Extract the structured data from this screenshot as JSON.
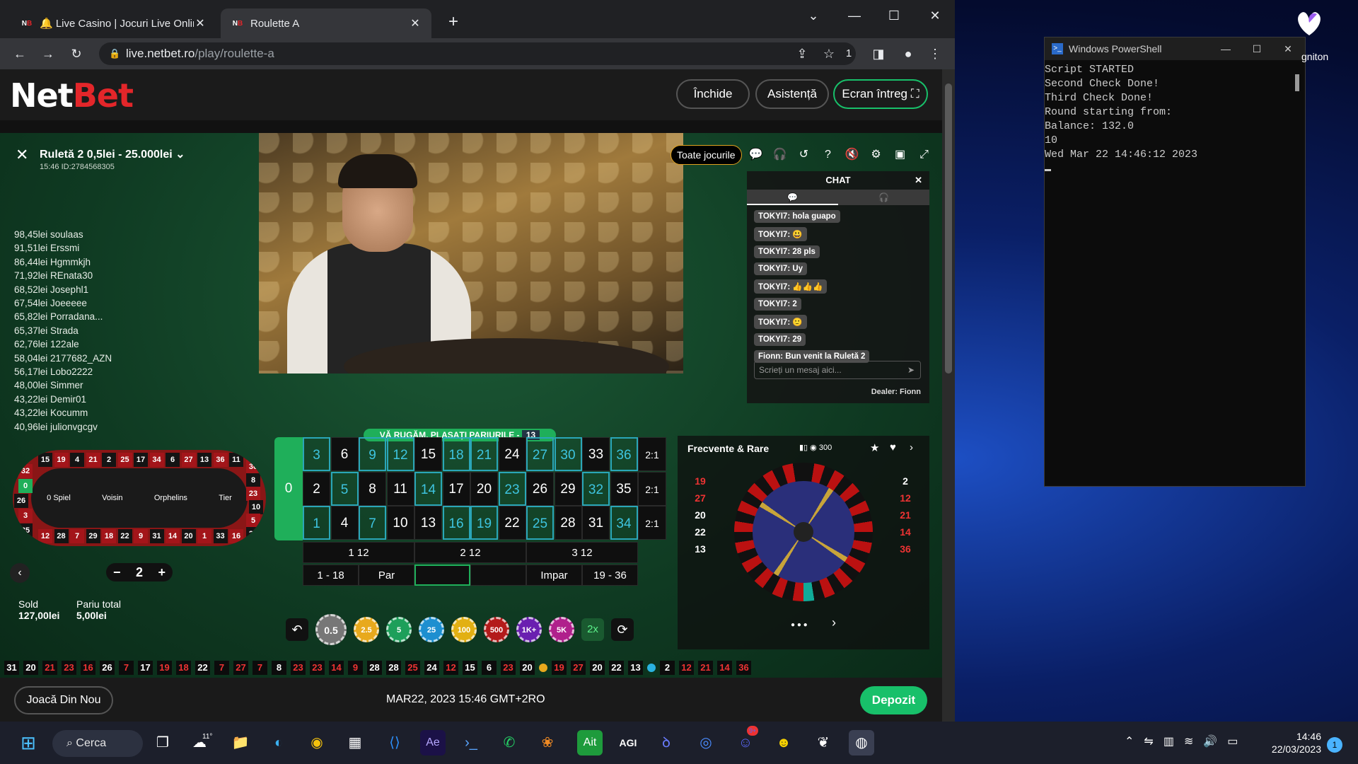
{
  "browser": {
    "tabs": [
      {
        "label": "🔔 Live Casino | Jocuri Live Online",
        "favicon": "NB"
      },
      {
        "label": "Roulette A",
        "favicon": "NB"
      }
    ],
    "url_host": "live.netbet.ro",
    "url_path": "/play/roulette-a",
    "extension_count": "1"
  },
  "netbet": {
    "logo_net": "Net",
    "logo_bet": "Bet",
    "header_buttons": {
      "close": "Închide",
      "help": "Asistență",
      "fullscreen": "Ecran întreg"
    },
    "table_title": "Ruletă 2 0,5lei - 25.000lei",
    "table_sub": "15:46  ID:2784568305",
    "all_games": "Toate jocurile",
    "winners": [
      "98,45lei soulaas",
      "91,51lei Erssmi",
      "86,44lei Hgmmkjh",
      "71,92lei REnata30",
      "68,52lei Josephl1",
      "67,54lei Joeeeee",
      "65,82lei Porradana...",
      "65,37lei Strada",
      "62,76lei 122ale",
      "58,04lei 2177682_AZN",
      "56,17lei Lobo2222",
      "48,00lei Simmer",
      "43,22lei Demir01",
      "43,22lei Kocumm",
      "40,96lei julionvgcgv"
    ],
    "chat": {
      "title": "CHAT",
      "messages": [
        "TOKYI7: hola guapo",
        "TOKYI7: 😃",
        "TOKYI7: 28 pls",
        "TOKYI7: Uy",
        "TOKYI7: 👍👍👍",
        "TOKYI7: 2",
        "TOKYI7: 🙂",
        "TOKYI7: 29",
        "Fionn: Bun venit la Ruletă 2"
      ],
      "placeholder": "Scrieți un mesaj aici...",
      "dealer": "Dealer: Fionn"
    },
    "place_bets": "VĂ RUGĂM, PLASAȚI PARIURILE -",
    "place_bets_count": "13",
    "racetrack": {
      "sections": [
        "0 Spiel",
        "Voisin",
        "Orphelins",
        "Tier"
      ],
      "top": [
        "15",
        "19",
        "4",
        "21",
        "2",
        "25",
        "17",
        "34",
        "6",
        "27",
        "13",
        "36",
        "11"
      ],
      "bottom": [
        "12",
        "28",
        "7",
        "29",
        "18",
        "22",
        "9",
        "31",
        "14",
        "20",
        "1",
        "33",
        "16"
      ],
      "left": [
        "32",
        "0",
        "26",
        "3",
        "35"
      ],
      "right": [
        "30",
        "8",
        "23",
        "10",
        "5",
        "24"
      ]
    },
    "neighbours": "2",
    "balance_label": "Sold",
    "balance": "127,00lei",
    "total_bet_label": "Pariu total",
    "total_bet": "5,00lei",
    "grid": {
      "zero": "0",
      "rows": [
        [
          "3",
          "6",
          "9",
          "12",
          "15",
          "18",
          "21",
          "24",
          "27",
          "30",
          "33",
          "36"
        ],
        [
          "2",
          "5",
          "8",
          "11",
          "14",
          "17",
          "20",
          "23",
          "26",
          "29",
          "32",
          "35"
        ],
        [
          "1",
          "4",
          "7",
          "10",
          "13",
          "16",
          "19",
          "22",
          "25",
          "28",
          "31",
          "34"
        ]
      ],
      "col_label": "2:1",
      "dozens": [
        "1 12",
        "2 12",
        "3 12"
      ],
      "outside": [
        "1 - 18",
        "Par",
        "",
        "",
        "Impar",
        "19 - 36"
      ],
      "highlighted": [
        "3",
        "9",
        "12",
        "18",
        "21",
        "27",
        "30",
        "36",
        "5",
        "14",
        "23",
        "32",
        "1",
        "7",
        "16",
        "19",
        "25",
        "34"
      ]
    },
    "chips": [
      "0.5",
      "2.5",
      "5",
      "25",
      "100",
      "500",
      "1K+",
      "5K"
    ],
    "double": "2x",
    "stats": {
      "title": "Frecvente & Rare",
      "slider_value": "300",
      "hot": [
        "19",
        "27",
        "20",
        "22",
        "13"
      ],
      "cold": [
        "2",
        "12",
        "21",
        "14",
        "36"
      ]
    },
    "history": [
      "31",
      "20",
      "21",
      "23",
      "16",
      "26",
      "7",
      "17",
      "19",
      "18",
      "22",
      "7",
      "27",
      "7",
      "8",
      "23",
      "23",
      "14",
      "9",
      "28",
      "28",
      "25",
      "24",
      "12",
      "15",
      "6",
      "23",
      "20"
    ],
    "history_red": [
      "21",
      "23",
      "16",
      "7",
      "19",
      "18",
      "27",
      "23",
      "14",
      "9",
      "25",
      "12"
    ],
    "history_hot": [
      "19",
      "27",
      "20",
      "22",
      "13"
    ],
    "history_cold": [
      "2",
      "12",
      "21",
      "14",
      "36"
    ],
    "footer": {
      "play_again": "Joacă Din Nou",
      "datetime": "MAR22, 2023  15:46 GMT+2RO",
      "deposit": "Depozit"
    }
  },
  "powershell": {
    "title": "Windows PowerShell",
    "lines": [
      "Script STARTED",
      "Second Check Done!",
      "Third Check Done!",
      "Round starting from:",
      "Balance: 132.0",
      "10",
      "Wed Mar 22 14:46:12 2023"
    ]
  },
  "desktop": {
    "icon_label": "gniton"
  },
  "taskbar": {
    "search": "Cerca",
    "weather": "11°",
    "time": "14:46",
    "date": "22/03/2023",
    "notifications": "1",
    "discord_badge": "9+"
  }
}
